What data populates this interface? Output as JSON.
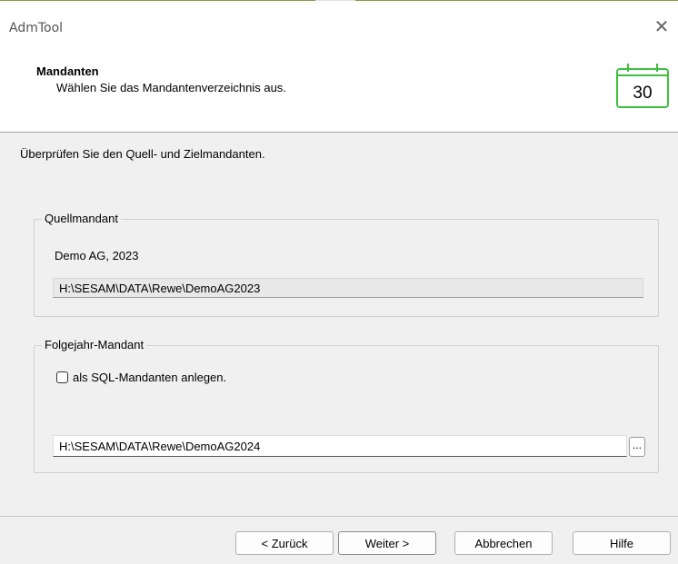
{
  "window": {
    "title": "AdmTool",
    "close_label": "✕"
  },
  "header": {
    "title": "Mandanten",
    "subtitle": "Wählen Sie das Mandantenverzeichnis aus.",
    "calendar_number": "30",
    "accent_color": "#3fbf3f"
  },
  "instruction": "Überprüfen Sie den Quell- und Zielmandanten.",
  "source": {
    "legend": "Quellmandant",
    "name": "Demo AG, 2023",
    "path": "H:\\SESAM\\DATA\\Rewe\\DemoAG2023"
  },
  "target": {
    "legend": "Folgejahr-Mandant",
    "sql_checkbox_label": "als SQL-Mandanten anlegen.",
    "sql_checked": false,
    "path": "H:\\SESAM\\DATA\\Rewe\\DemoAG2024",
    "browse_label": "..."
  },
  "buttons": {
    "back": "< Zurück",
    "next": "Weiter >",
    "cancel": "Abbrechen",
    "help": "Hilfe"
  }
}
